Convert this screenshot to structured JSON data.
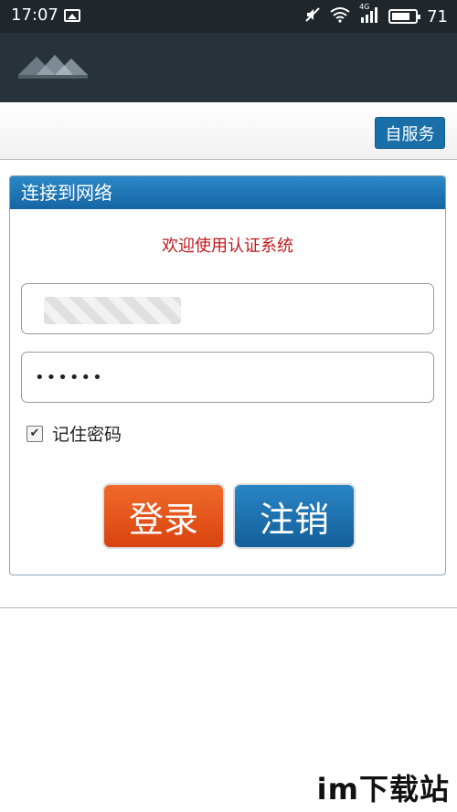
{
  "status_bar": {
    "time": "17:07",
    "network": "4G",
    "battery_level": "71",
    "icons": [
      "image-icon",
      "mute-icon",
      "wifi-icon",
      "signal-icon",
      "battery-icon"
    ]
  },
  "toolbar": {
    "self_service_label": "自服务"
  },
  "panel": {
    "title": "连接到网络",
    "welcome": "欢迎使用认证系统",
    "username_value": "",
    "password_value": "••••••",
    "remember_label": "记住密码",
    "remember_checked": true,
    "login_label": "登录",
    "logout_label": "注销"
  },
  "colors": {
    "header_bg": "#27323a",
    "panel_head": "#1a6fa8",
    "welcome_text": "#c0181c",
    "login_btn": "#e2521a",
    "logout_btn": "#1a6fa8"
  },
  "watermark": "im下载站"
}
